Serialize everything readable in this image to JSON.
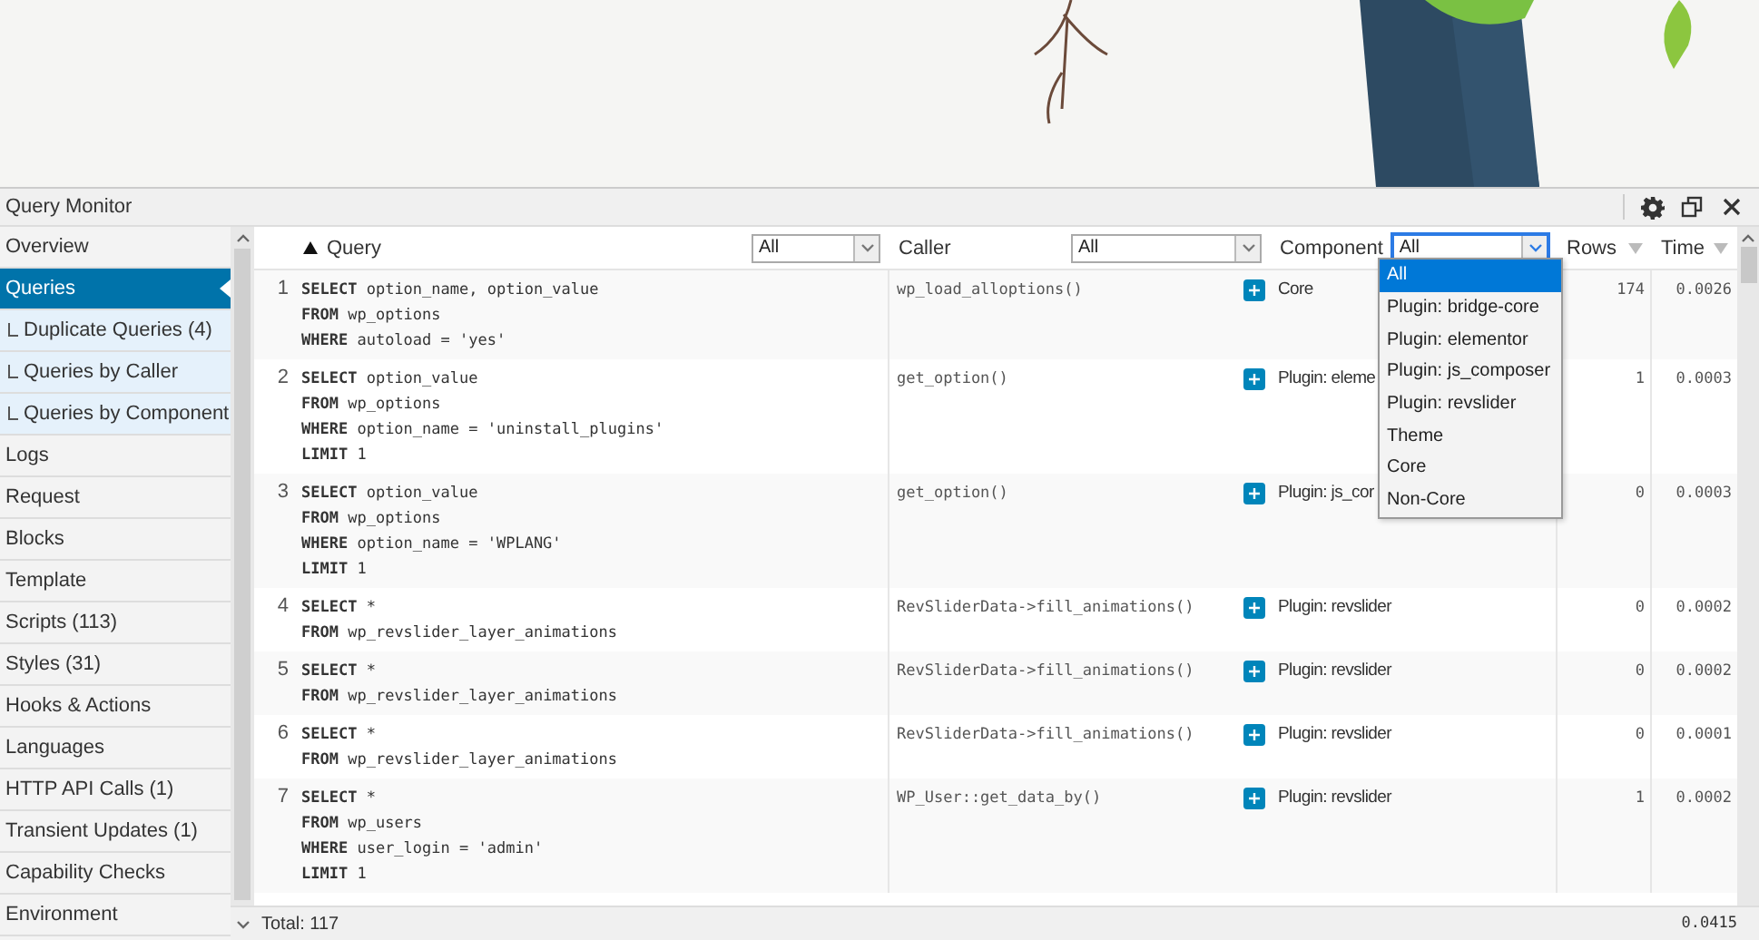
{
  "panel": {
    "title": "Query Monitor"
  },
  "sidebar": {
    "items": [
      {
        "label": "Overview",
        "selected": false
      },
      {
        "label": "Queries",
        "selected": true,
        "children": [
          {
            "label": "Duplicate Queries (4)",
            "selected": false
          },
          {
            "label": "Queries by Caller",
            "selected": false
          },
          {
            "label": "Queries by Component",
            "selected": false
          }
        ]
      },
      {
        "label": "Logs",
        "selected": false
      },
      {
        "label": "Request",
        "selected": false
      },
      {
        "label": "Blocks",
        "selected": false
      },
      {
        "label": "Template",
        "selected": false
      },
      {
        "label": "Scripts (113)",
        "selected": false
      },
      {
        "label": "Styles (31)",
        "selected": false
      },
      {
        "label": "Hooks & Actions",
        "selected": false
      },
      {
        "label": "Languages",
        "selected": false
      },
      {
        "label": "HTTP API Calls (1)",
        "selected": false
      },
      {
        "label": "Transient Updates (1)",
        "selected": false
      },
      {
        "label": "Capability Checks",
        "selected": false
      },
      {
        "label": "Environment",
        "selected": false
      }
    ]
  },
  "table": {
    "columns": [
      {
        "label": "Query",
        "sorted": true,
        "filter": "All",
        "open": false
      },
      {
        "label": "Caller",
        "filter": "All",
        "open": false
      },
      {
        "label": "Component",
        "filter": "All",
        "open": true
      },
      {
        "label": "Rows",
        "sorted": false
      },
      {
        "label": "Time",
        "sorted": false
      }
    ],
    "rows": [
      {
        "number": "1",
        "query": [
          "**SELECT** option_name, option_value",
          "**FROM** wp_options",
          "**WHERE** autoload = 'yes'"
        ],
        "caller": "wp_load_alloptions()",
        "component": "Core",
        "rows": "174",
        "time": "0.0026"
      },
      {
        "number": "2",
        "query": [
          "**SELECT** option_value",
          "**FROM** wp_options",
          "**WHERE** option_name = 'uninstall_plugins'",
          "**LIMIT** 1"
        ],
        "caller": "get_option()",
        "component": "Plugin: eleme",
        "rows": "1",
        "time": "0.0003"
      },
      {
        "number": "3",
        "query": [
          "**SELECT** option_value",
          "**FROM** wp_options",
          "**WHERE** option_name = 'WPLANG'",
          "**LIMIT** 1"
        ],
        "caller": "get_option()",
        "component": "Plugin: js_cor",
        "rows": "0",
        "time": "0.0003"
      },
      {
        "number": "4",
        "query": [
          "**SELECT** *",
          "**FROM** wp_revslider_layer_animations"
        ],
        "caller": "RevSliderData->fill_animations()",
        "component": "Plugin: revslider",
        "rows": "0",
        "time": "0.0002"
      },
      {
        "number": "5",
        "query": [
          "**SELECT** *",
          "**FROM** wp_revslider_layer_animations"
        ],
        "caller": "RevSliderData->fill_animations()",
        "component": "Plugin: revslider",
        "rows": "0",
        "time": "0.0002"
      },
      {
        "number": "6",
        "query": [
          "**SELECT** *",
          "**FROM** wp_revslider_layer_animations"
        ],
        "caller": "RevSliderData->fill_animations()",
        "component": "Plugin: revslider",
        "rows": "0",
        "time": "0.0001"
      },
      {
        "number": "7",
        "query": [
          "**SELECT** *",
          "**FROM** wp_users",
          "**WHERE** user_login = 'admin'",
          "**LIMIT** 1"
        ],
        "caller": "WP_User::get_data_by()",
        "component": "Plugin: revslider",
        "rows": "1",
        "time": "0.0002"
      }
    ]
  },
  "component_dropdown": {
    "options": [
      {
        "label": "All",
        "selected": true
      },
      {
        "label": "Plugin: bridge-core",
        "selected": false
      },
      {
        "label": "Plugin: elementor",
        "selected": false
      },
      {
        "label": "Plugin: js_composer",
        "selected": false
      },
      {
        "label": "Plugin: revslider",
        "selected": false
      },
      {
        "label": "Theme",
        "selected": false
      },
      {
        "label": "Core",
        "selected": false
      },
      {
        "label": "Non-Core",
        "selected": false
      }
    ]
  },
  "footer": {
    "total": "Total: 117",
    "time": "0.0415"
  }
}
